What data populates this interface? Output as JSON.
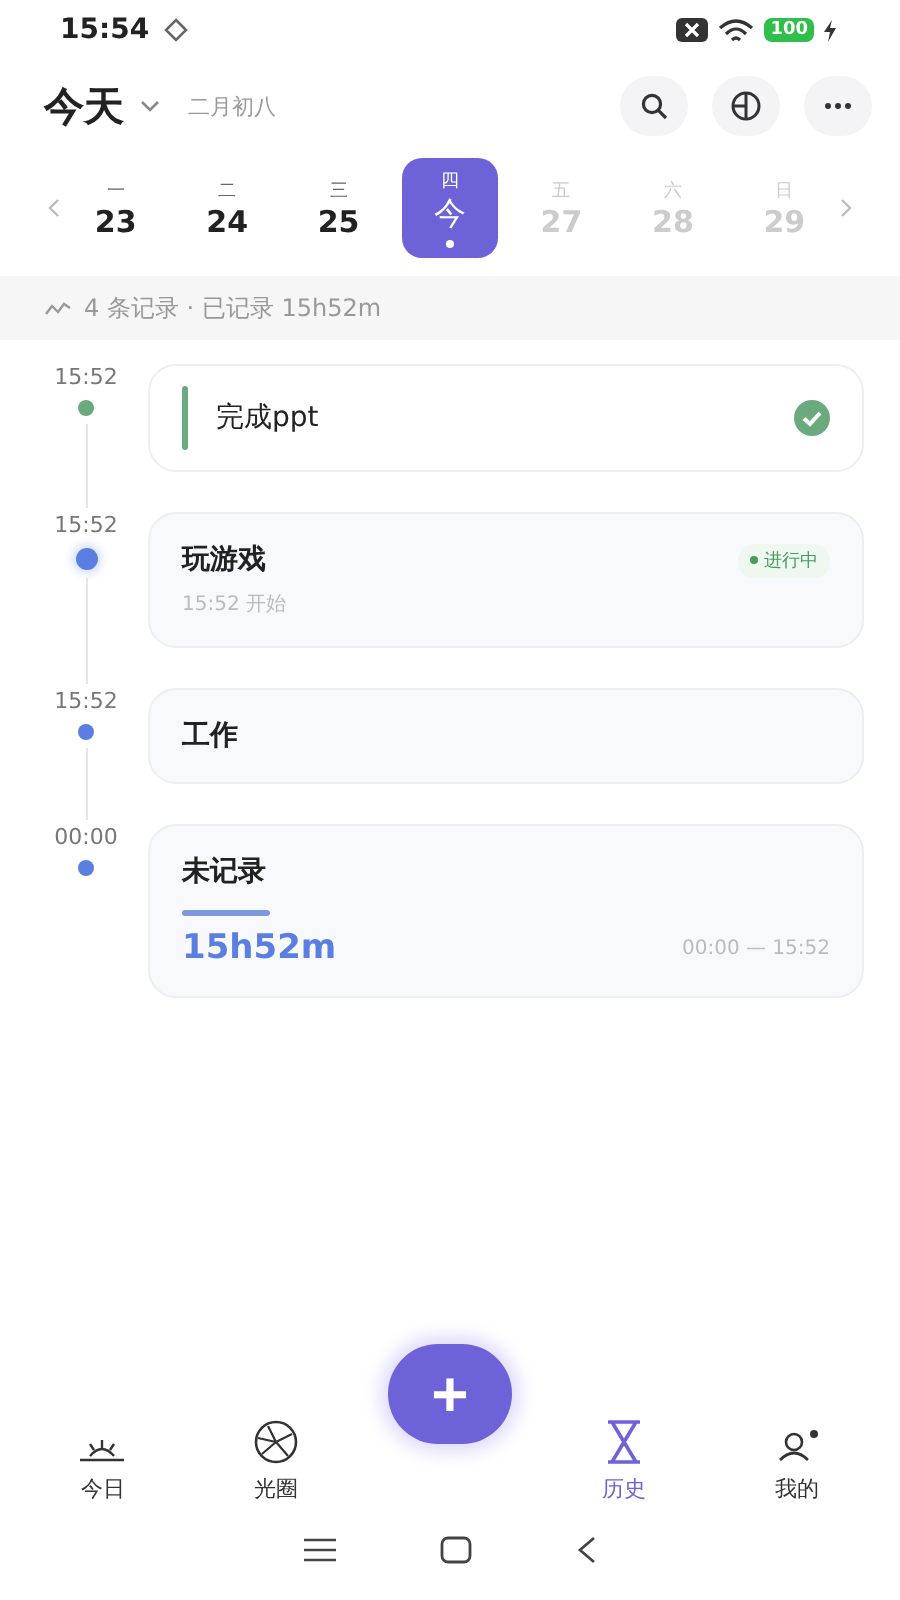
{
  "status_bar": {
    "time": "15:54",
    "battery": "100"
  },
  "header": {
    "title": "今天",
    "lunar_date": "二月初八"
  },
  "week": [
    {
      "weekday": "一",
      "label": "23",
      "selected": false,
      "future": false
    },
    {
      "weekday": "二",
      "label": "24",
      "selected": false,
      "future": false
    },
    {
      "weekday": "三",
      "label": "25",
      "selected": false,
      "future": false
    },
    {
      "weekday": "四",
      "label": "今",
      "selected": true,
      "future": false
    },
    {
      "weekday": "五",
      "label": "27",
      "selected": false,
      "future": true
    },
    {
      "weekday": "六",
      "label": "28",
      "selected": false,
      "future": true
    },
    {
      "weekday": "日",
      "label": "29",
      "selected": false,
      "future": true
    }
  ],
  "summary": "4 条记录 · 已记录 15h52m",
  "records": [
    {
      "kind": "done",
      "time": "15:52",
      "title": "完成ppt",
      "color": "#6aaa7e"
    },
    {
      "kind": "running",
      "time": "15:52",
      "title": "玩游戏",
      "badge": "进行中",
      "subtitle": "15:52 开始",
      "color": "#5b7fe0"
    },
    {
      "kind": "plain",
      "time": "15:52",
      "title": "工作",
      "color": "#5b7fe0"
    },
    {
      "kind": "unrecorded",
      "time": "00:00",
      "title": "未记录",
      "duration": "15h52m",
      "range": "00:00 — 15:52",
      "color": "#5b7fe0"
    }
  ],
  "fab": "+",
  "tabs": [
    {
      "label": "今日",
      "selected": false
    },
    {
      "label": "光圈",
      "selected": false
    },
    {
      "label": "历史",
      "selected": true
    },
    {
      "label": "我的",
      "selected": false
    }
  ]
}
